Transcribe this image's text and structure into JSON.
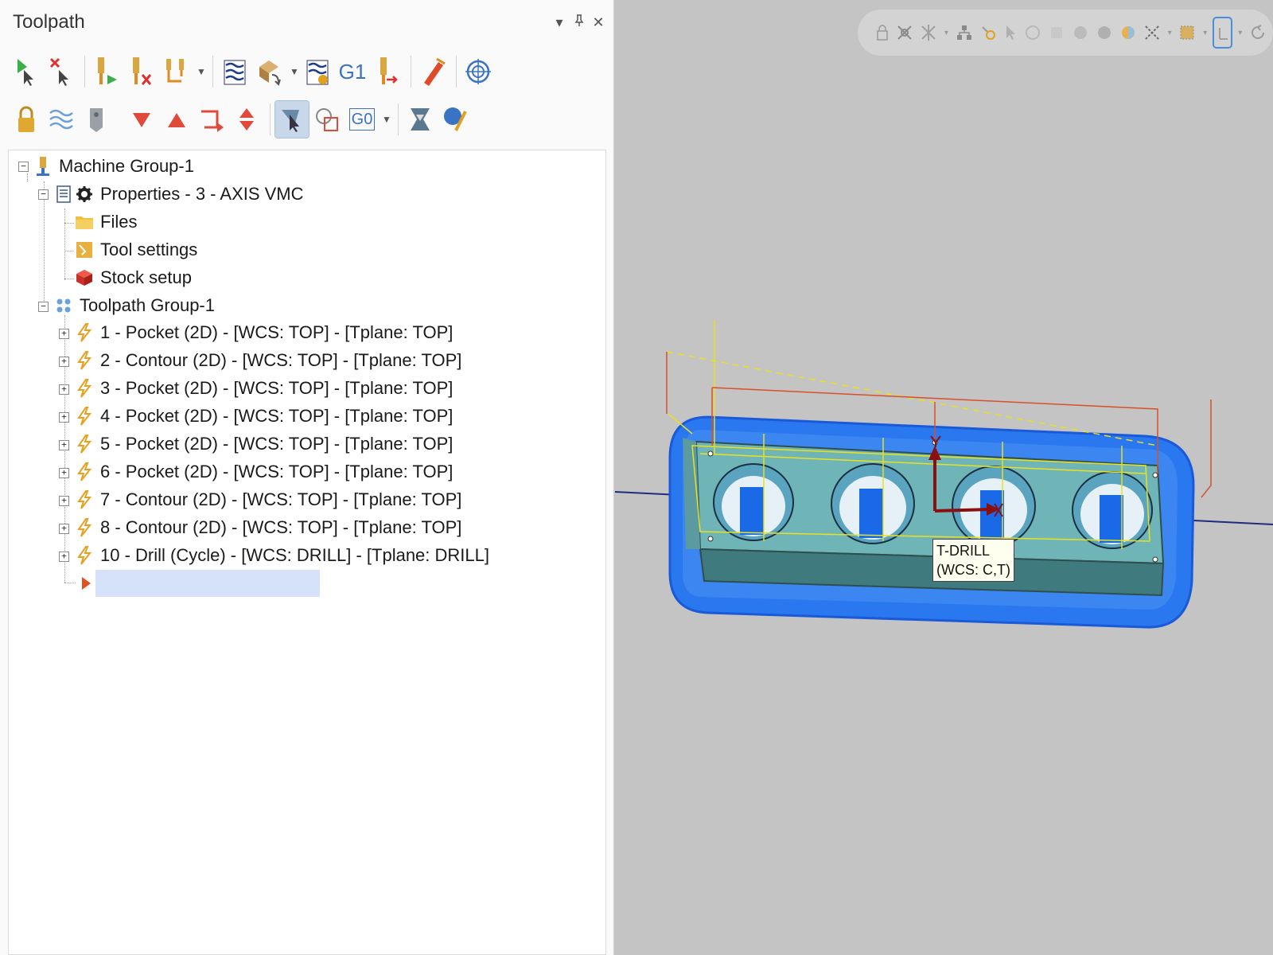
{
  "panel": {
    "title": "Toolpath",
    "controls": [
      "▾",
      "⊥",
      "✕"
    ]
  },
  "toolbar": {
    "row1": [
      "select-all-operations-icon",
      "select-all-failed-icon",
      "regenerate-selected-icon",
      "regenerate-dirty-icon",
      "toggle-display-icon",
      "backplot-icon",
      "verify-icon",
      "simulate-icon",
      "g1-post-icon",
      "high-speed-icon",
      "edit-icon",
      "target-icon"
    ],
    "g1_label": "G1",
    "g0_label": "G0",
    "row2": [
      "lock-icon",
      "toggle-posting-icon",
      "tool-icon",
      "move-down-icon",
      "move-up-icon",
      "insert-arrow-icon",
      "expand-collapse-icon",
      "show-selected-icon",
      "show-geometry-icon",
      "g0-display-icon",
      "ops-manager-icon",
      "help-icon"
    ]
  },
  "tree": {
    "machine_group": "Machine Group-1",
    "properties": "Properties - 3 - AXIS VMC",
    "files": "Files",
    "tool_settings": "Tool settings",
    "stock_setup": "Stock setup",
    "toolpath_group": "Toolpath Group-1",
    "operations": [
      "1 - Pocket (2D) - [WCS: TOP] - [Tplane: TOP]",
      "2 - Contour (2D) - [WCS: TOP] - [Tplane: TOP]",
      "3 - Pocket (2D) - [WCS: TOP] - [Tplane: TOP]",
      "4 - Pocket (2D) - [WCS: TOP] - [Tplane: TOP]",
      "5 - Pocket (2D) - [WCS: TOP] - [Tplane: TOP]",
      "6 - Pocket (2D) - [WCS: TOP] - [Tplane: TOP]",
      "7 - Contour (2D) - [WCS: TOP] - [Tplane: TOP]",
      "8 - Contour (2D) - [WCS: TOP] - [Tplane: TOP]",
      "10 - Drill (Cycle) - [WCS: DRILL] - [Tplane: DRILL]"
    ]
  },
  "viewport": {
    "tooltip_line1": "T-DRILL",
    "tooltip_line2": "(WCS: C,T)"
  },
  "colors": {
    "bolt": "#e8a020",
    "stock_blue": "#1e6fe8",
    "part_teal": "#6fb3b8",
    "insert_arrow": "#e05020"
  }
}
